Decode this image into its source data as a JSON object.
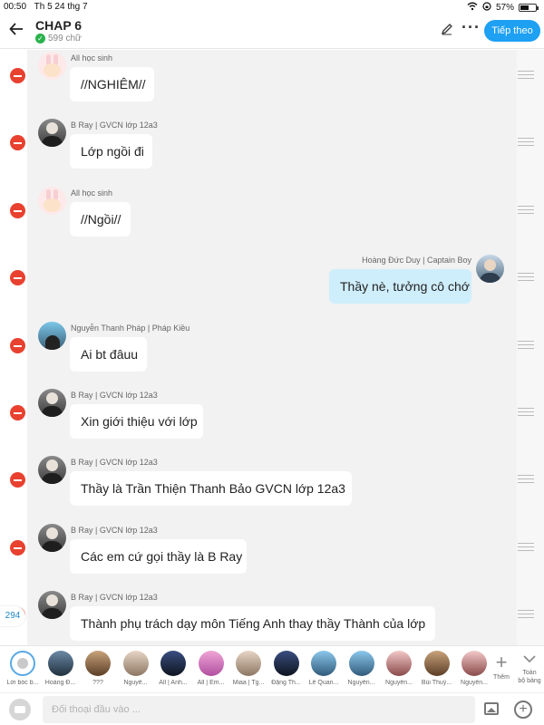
{
  "status_bar": {
    "time": "00:50",
    "date": "Th 5 24 thg 7",
    "battery": "57%",
    "battery_level": 0.57
  },
  "header": {
    "title": "CHAP 6",
    "word_count": "599 chữ",
    "next_label": "Tiếp theo"
  },
  "messages": [
    {
      "sender": "All học sinh",
      "text": "//NGHIÊM//",
      "side": "left",
      "avatar": "bunny"
    },
    {
      "sender": "B Ray | GVCN lớp 12a3",
      "text": "Lớp ngồi đi",
      "side": "left",
      "avatar": "gray"
    },
    {
      "sender": "All học sinh",
      "text": "//Ngồi//",
      "side": "left",
      "avatar": "bunny"
    },
    {
      "sender": "Hoàng Đức Duy | Captain Boy",
      "text": "Thầy nè, tưởng cô chớ",
      "side": "right",
      "avatar": "dark"
    },
    {
      "sender": "Nguyễn Thanh Pháp | Pháp Kiều",
      "text": "Ai bt đâuu",
      "side": "left",
      "avatar": "sea"
    },
    {
      "sender": "B Ray | GVCN lớp 12a3",
      "text": "Xin giới thiệu với lớp",
      "side": "left",
      "avatar": "gray"
    },
    {
      "sender": "B Ray | GVCN lớp 12a3",
      "text": "Thầy là Trần Thiện Thanh Bảo GVCN lớp 12a3",
      "side": "left",
      "avatar": "gray"
    },
    {
      "sender": "B Ray | GVCN lớp 12a3",
      "text": "Các em cứ gọi thầy là B Ray",
      "side": "left",
      "avatar": "gray"
    },
    {
      "sender": "B Ray | GVCN lớp 12a3",
      "text": "Thành phụ trách dạy môn Tiếng Anh thay thầy Thành của lớp",
      "side": "left",
      "avatar": "gray"
    }
  ],
  "unread_count": "294",
  "characters": [
    {
      "name": "Lời bốc b...",
      "style": "narr"
    },
    {
      "name": "Hoàng Đ...",
      "style": "c-dark"
    },
    {
      "name": "???",
      "style": "c-brown"
    },
    {
      "name": "Nguyễ...",
      "style": "c-light"
    },
    {
      "name": "All | Anh...",
      "style": "c-navy"
    },
    {
      "name": "All | Em...",
      "style": "c-pink"
    },
    {
      "name": "Miaa | Tg...",
      "style": "c-light"
    },
    {
      "name": "Đặng Th...",
      "style": "c-navy"
    },
    {
      "name": "Lê Quan...",
      "style": "c-blue"
    },
    {
      "name": "Nguyễn...",
      "style": "c-blue"
    },
    {
      "name": "Nguyễn...",
      "style": "c-rose"
    },
    {
      "name": "Bùi Thuý...",
      "style": "c-brown"
    },
    {
      "name": "Nguyễn...",
      "style": "c-rose"
    }
  ],
  "character_bar": {
    "add_label": "Thêm",
    "all_label_line1": "Toàn",
    "all_label_line2": "bộ bảng"
  },
  "composer": {
    "placeholder": "Đối thoại đầu vào ..."
  }
}
